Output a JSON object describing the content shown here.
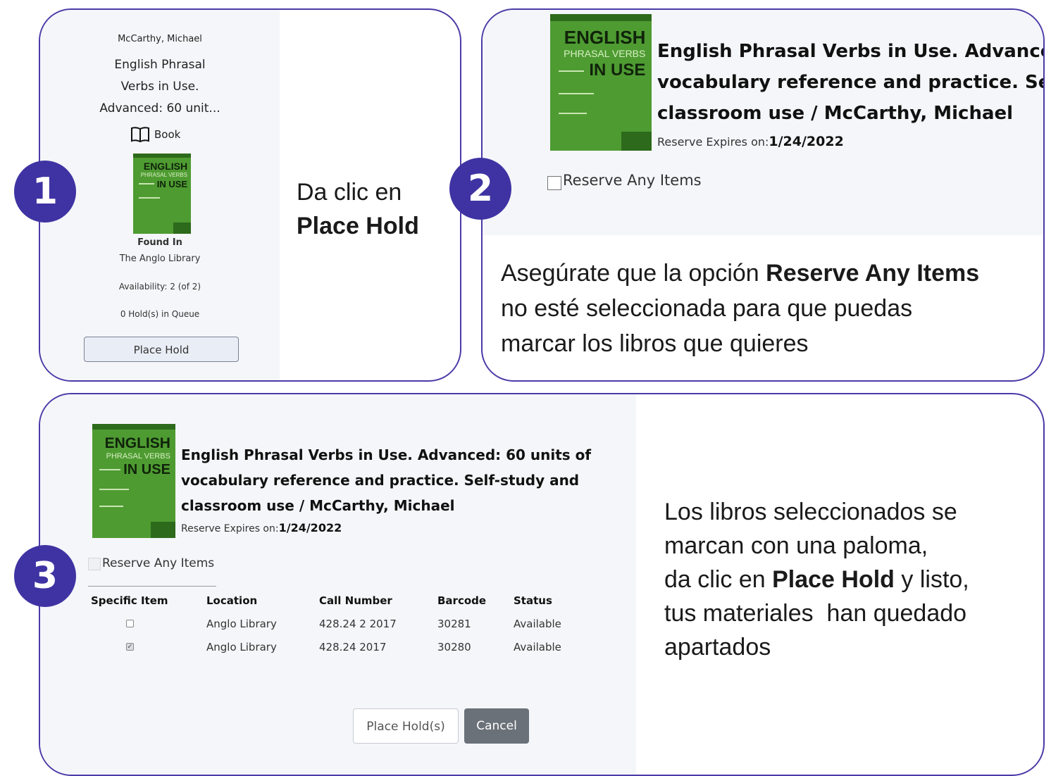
{
  "step1": {
    "badge": "1",
    "author": "McCarthy, Michael",
    "title_lines": [
      "English Phrasal",
      "Verbs in Use.",
      "Advanced: 60 unit..."
    ],
    "format_label": "Book",
    "found_in_label": "Found In",
    "library": "The Anglo Library",
    "availability": "Availability: 2 (of 2)",
    "holds": "0 Hold(s) in Queue",
    "place_hold_button": "Place Hold",
    "instruction_line1": "Da clic en",
    "instruction_bold": "Place Hold"
  },
  "cover": {
    "english": "ENGLISH",
    "phrasal_verbs": "PHRASAL VERBS",
    "in_use": "IN USE",
    "colors": {
      "green": "#4e9b32",
      "dark_green": "#2d6a1b"
    }
  },
  "step2": {
    "badge": "2",
    "title_lines": [
      "English Phrasal Verbs in Use. Advanced:",
      "vocabulary reference and practice. Self-s",
      "classroom use / McCarthy, Michael"
    ],
    "reserve_expires_label": "Reserve Expires on:",
    "reserve_expires_date": "1/24/2022",
    "reserve_any_label": "Reserve Any Items",
    "instruction_pre": "Asegúrate que la opción ",
    "instruction_bold": "Reserve Any Items",
    "instruction_line2": "no esté seleccionada para que puedas",
    "instruction_line3": "marcar los libros que quieres"
  },
  "step3": {
    "badge": "3",
    "title_lines": [
      "English Phrasal Verbs in Use. Advanced: 60 units of",
      "vocabulary reference and practice. Self-study and",
      "classroom use / McCarthy, Michael"
    ],
    "reserve_expires_label": "Reserve Expires on:",
    "reserve_expires_date": "1/24/2022",
    "reserve_any_label": "Reserve Any Items",
    "table": {
      "headers": [
        "Specific Item",
        "Location",
        "Call Number",
        "Barcode",
        "Status"
      ],
      "rows": [
        {
          "checked": false,
          "location": "Anglo Library",
          "call_number": "428.24 2 2017",
          "barcode": "30281",
          "status": "Available"
        },
        {
          "checked": true,
          "location": "Anglo Library",
          "call_number": "428.24 2017",
          "barcode": "30280",
          "status": "Available"
        }
      ]
    },
    "place_holds_button": "Place Hold(s)",
    "cancel_button": "Cancel",
    "instruction_line1": "Los libros seleccionados se",
    "instruction_line2": "marcan con una paloma,",
    "instruction_line3_pre": "da clic en ",
    "instruction_line3_bold": "Place Hold",
    "instruction_line3_post": " y listo,",
    "instruction_line4": "tus materiales  han quedado",
    "instruction_line5": "apartados"
  },
  "accent_color": "#3f33a3"
}
